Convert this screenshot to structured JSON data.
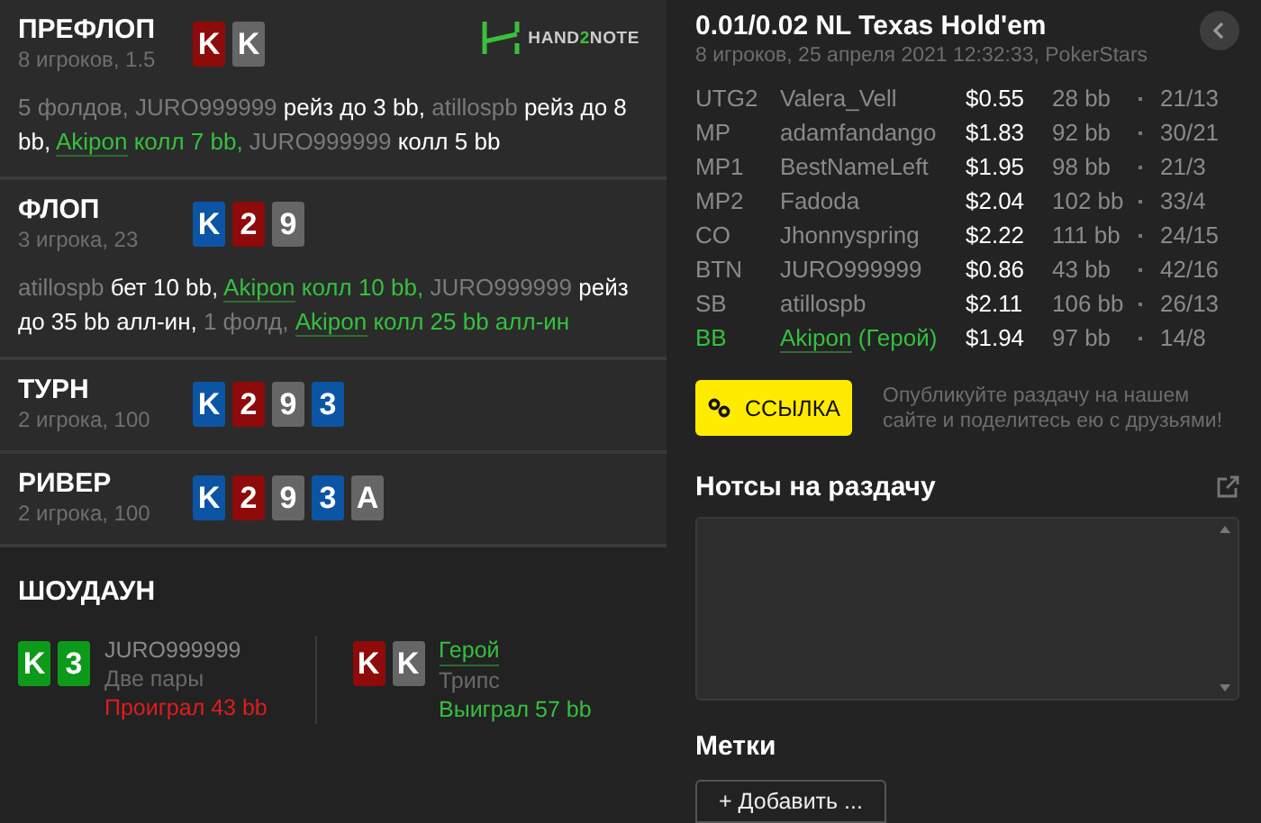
{
  "streets": [
    {
      "title": "ПРЕФЛОП",
      "info": "8 игроков, 1.5",
      "cards": [
        {
          "rank": "K",
          "color": "#8f0a0a"
        },
        {
          "rank": "K",
          "color": "#666666"
        }
      ],
      "actions": [
        {
          "kind": "player",
          "text": "5 фолдов, JURO999999"
        },
        {
          "kind": "action",
          "text": " рейз до 3 bb, "
        },
        {
          "kind": "player",
          "text": "atillospb"
        },
        {
          "kind": "action",
          "text": " рейз до 8 bb, "
        },
        {
          "kind": "hero",
          "text": "Akipon"
        },
        {
          "kind": "hero-action",
          "text": " колл 7 bb, "
        },
        {
          "kind": "player",
          "text": "JURO999999"
        },
        {
          "kind": "action",
          "text": " колл 5 bb"
        }
      ]
    },
    {
      "title": "ФЛОП",
      "info": "3 игрока, 23",
      "cards": [
        {
          "rank": "K",
          "color": "#0c55a5"
        },
        {
          "rank": "2",
          "color": "#8f0a0a"
        },
        {
          "rank": "9",
          "color": "#666666"
        }
      ],
      "actions": [
        {
          "kind": "player",
          "text": "atillospb"
        },
        {
          "kind": "action",
          "text": " бет 10 bb, "
        },
        {
          "kind": "hero",
          "text": "Akipon"
        },
        {
          "kind": "hero-action",
          "text": " колл 10 bb, "
        },
        {
          "kind": "player",
          "text": "JURO999999"
        },
        {
          "kind": "action",
          "text": " рейз до 35 bb алл-ин, "
        },
        {
          "kind": "player",
          "text": "1 фолд, "
        },
        {
          "kind": "hero",
          "text": "Akipon"
        },
        {
          "kind": "hero-action",
          "text": " колл 25 bb алл-ин"
        }
      ]
    },
    {
      "title": "ТУРН",
      "info": "2 игрока, 100",
      "cards": [
        {
          "rank": "K",
          "color": "#0c55a5"
        },
        {
          "rank": "2",
          "color": "#8f0a0a"
        },
        {
          "rank": "9",
          "color": "#666666"
        },
        {
          "rank": "3",
          "color": "#0c55a5"
        }
      ]
    },
    {
      "title": "РИВЕР",
      "info": "2 игрока, 100",
      "cards": [
        {
          "rank": "K",
          "color": "#0c55a5"
        },
        {
          "rank": "2",
          "color": "#8f0a0a"
        },
        {
          "rank": "9",
          "color": "#666666"
        },
        {
          "rank": "3",
          "color": "#0c55a5"
        },
        {
          "rank": "A",
          "color": "#666666"
        }
      ]
    }
  ],
  "logo": {
    "parts": [
      "HAND",
      "2",
      "NOTE"
    ]
  },
  "showdown": {
    "title": "ШОУДАУН",
    "players": [
      {
        "name": "JURO999999",
        "hero": false,
        "hand": "Две пары",
        "result": "Проиграл 43 bb",
        "won": false,
        "cards": [
          {
            "rank": "K",
            "color": "#0d9a1a"
          },
          {
            "rank": "3",
            "color": "#0d9a1a"
          }
        ]
      },
      {
        "name": "Герой",
        "hero": true,
        "hand": "Трипс",
        "result": "Выиграл 57 bb",
        "won": true,
        "cards": [
          {
            "rank": "K",
            "color": "#8f0a0a"
          },
          {
            "rank": "K",
            "color": "#666666"
          }
        ]
      }
    ]
  },
  "game": {
    "title": "0.01/0.02 NL Texas Hold'em",
    "info": "8 игроков, 25 апреля 2021 12:32:33, PokerStars"
  },
  "players": [
    {
      "position": "UTG2",
      "name": "Valera_Vell",
      "hero": false,
      "stack": "$0.55",
      "bb": "28 bb",
      "stats": "21/13"
    },
    {
      "position": "MP",
      "name": "adamfandango",
      "hero": false,
      "stack": "$1.83",
      "bb": "92 bb",
      "stats": "30/21"
    },
    {
      "position": "MP1",
      "name": "BestNameLeft",
      "hero": false,
      "stack": "$1.95",
      "bb": "98 bb",
      "stats": "21/3"
    },
    {
      "position": "MP2",
      "name": "Fadoda",
      "hero": false,
      "stack": "$2.04",
      "bb": "102 bb",
      "stats": "33/4"
    },
    {
      "position": "CO",
      "name": "Jhonnyspring",
      "hero": false,
      "stack": "$2.22",
      "bb": "111 bb",
      "stats": "24/15"
    },
    {
      "position": "BTN",
      "name": "JURO999999",
      "hero": false,
      "stack": "$0.86",
      "bb": "43 bb",
      "stats": "42/16"
    },
    {
      "position": "SB",
      "name": "atillospb",
      "hero": false,
      "stack": "$2.11",
      "bb": "106 bb",
      "stats": "26/13"
    },
    {
      "position": "BB",
      "name": "Akipon",
      "hero_tag": "(Герой)",
      "hero": true,
      "stack": "$1.94",
      "bb": "97 bb",
      "stats": "14/8"
    }
  ],
  "link_button": "ССЫЛКА",
  "share_hint": "Опубликуйте раздачу на нашем сайте и поделитесь ею с друзьями!",
  "notes": {
    "title": "Нотсы на раздачу"
  },
  "tags": {
    "title": "Метки",
    "add_button": "+ Добавить ..."
  }
}
